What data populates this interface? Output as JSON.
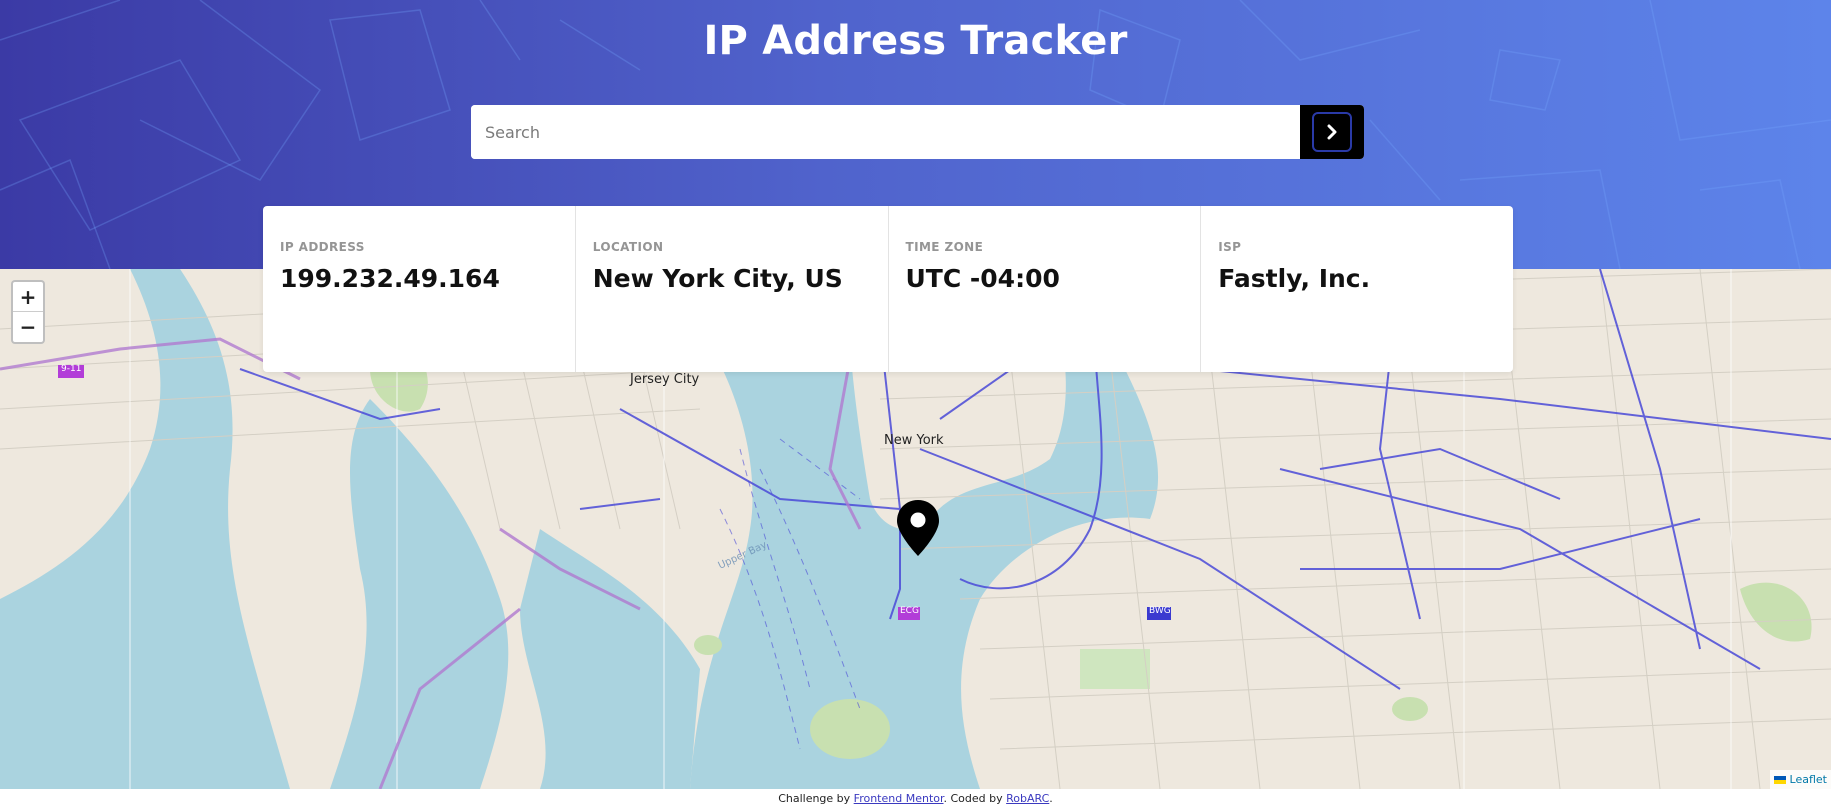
{
  "header": {
    "title": "IP Address Tracker",
    "search": {
      "placeholder": "Search",
      "value": ""
    },
    "submit_icon": "chevron-right-icon"
  },
  "info": {
    "ip": {
      "label": "IP ADDRESS",
      "value": "199.232.49.164"
    },
    "location": {
      "label": "LOCATION",
      "value": "New York City, US"
    },
    "timezone": {
      "label": "TIME ZONE",
      "value": "UTC -04:00"
    },
    "isp": {
      "label": "ISP",
      "value": "Fastly, Inc."
    }
  },
  "map": {
    "zoom_in": "+",
    "zoom_out": "−",
    "labels": {
      "jersey_city": "Jersey City",
      "new_york": "New York",
      "badge_911": "9-11",
      "badge_ecg": "ECG",
      "badge_bwg": "BWG"
    },
    "marker_icon": "map-pin-icon",
    "attribution": "Leaflet",
    "colors": {
      "water": "#aad3df",
      "land": "#eee8de",
      "route": "#4a4ad8",
      "park": "#c8e0b0"
    }
  },
  "footer": {
    "prefix": "Challenge by",
    "challenge_link": "Frontend Mentor",
    "middle": ". Coded by",
    "coder_link": "RobARC",
    "suffix": "."
  }
}
